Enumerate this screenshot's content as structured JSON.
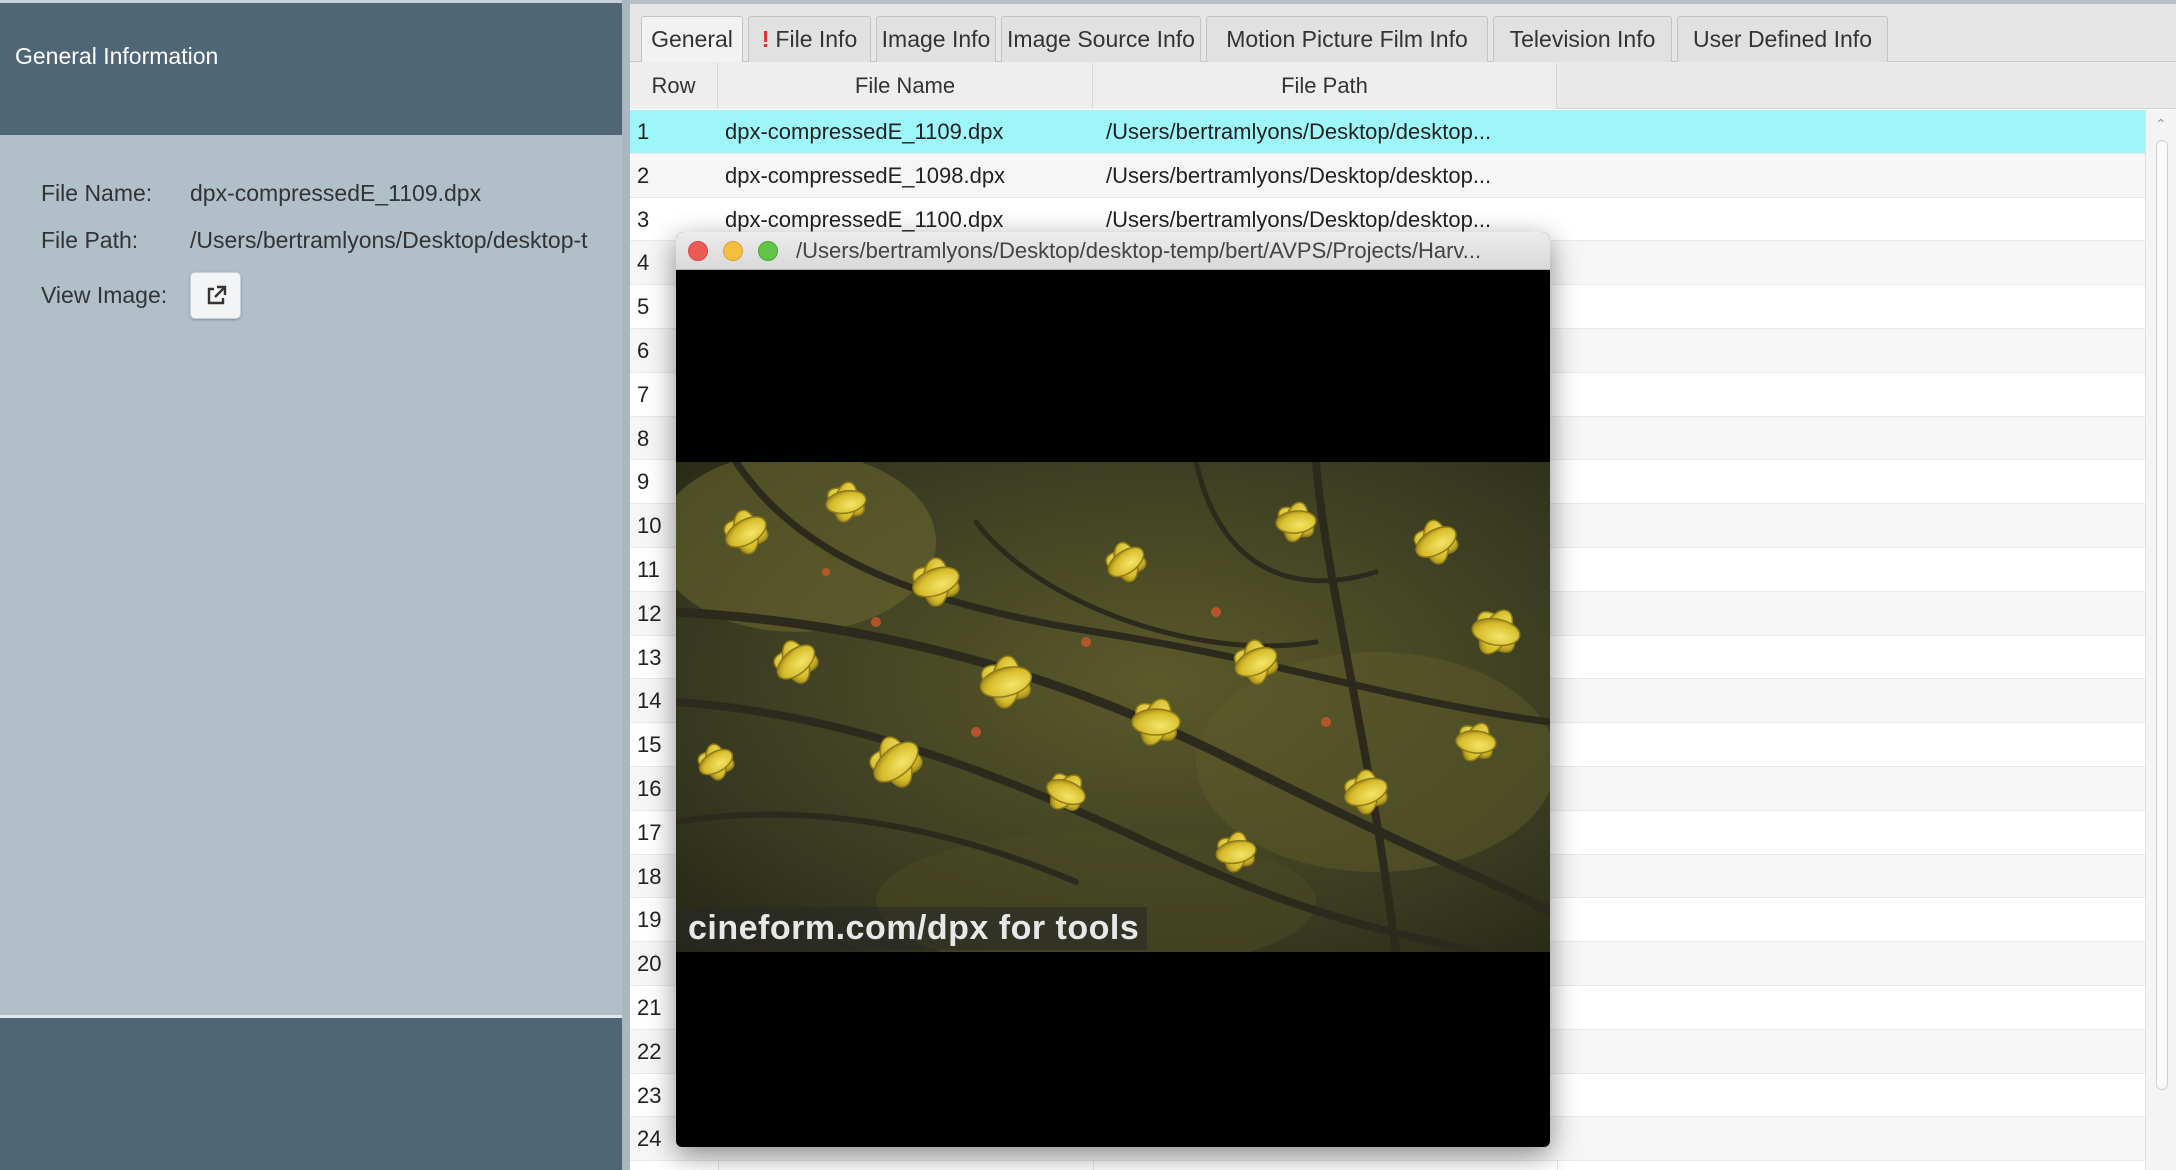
{
  "left_panel": {
    "title": "General Information",
    "file_name_label": "File Name:",
    "file_name_value": "dpx-compressedE_1109.dpx",
    "file_path_label": "File Path:",
    "file_path_value": "/Users/bertramlyons/Desktop/desktop-t",
    "view_image_label": "View Image:",
    "view_image_icon": "external-link-icon"
  },
  "tabs": [
    {
      "label": "General",
      "active": true
    },
    {
      "label": "File Info",
      "warning": "!"
    },
    {
      "label": "Image Info"
    },
    {
      "label": "Image Source Info"
    },
    {
      "label": "Motion Picture Film Info"
    },
    {
      "label": "Television Info"
    },
    {
      "label": "User Defined Info"
    }
  ],
  "table": {
    "headers": {
      "row": "Row",
      "file_name": "File Name",
      "file_path": "File Path"
    },
    "rows": [
      {
        "row": "1",
        "file_name": "dpx-compressedE_1109.dpx",
        "file_path": "/Users/bertramlyons/Desktop/desktop...",
        "selected": true
      },
      {
        "row": "2",
        "file_name": "dpx-compressedE_1098.dpx",
        "file_path": "/Users/bertramlyons/Desktop/desktop..."
      },
      {
        "row": "3",
        "file_name": "dpx-compressedE_1100.dpx",
        "file_path": "/Users/bertramlyons/Desktop/desktop..."
      },
      {
        "row": "4"
      },
      {
        "row": "5"
      },
      {
        "row": "6"
      },
      {
        "row": "7"
      },
      {
        "row": "8"
      },
      {
        "row": "9"
      },
      {
        "row": "10"
      },
      {
        "row": "11"
      },
      {
        "row": "12"
      },
      {
        "row": "13"
      },
      {
        "row": "14"
      },
      {
        "row": "15"
      },
      {
        "row": "16"
      },
      {
        "row": "17"
      },
      {
        "row": "18"
      },
      {
        "row": "19"
      },
      {
        "row": "20"
      },
      {
        "row": "21"
      },
      {
        "row": "22"
      },
      {
        "row": "23"
      },
      {
        "row": "24"
      }
    ]
  },
  "viewer": {
    "title": "/Users/bertramlyons/Desktop/desktop-temp/bert/AVPS/Projects/Harv...",
    "image_caption": "cineform.com/dpx for tools"
  },
  "colors": {
    "selection": "#9ef6f8",
    "left_header": "#4f6677",
    "left_body": "#b1bfc9",
    "warning": "#e03030"
  }
}
